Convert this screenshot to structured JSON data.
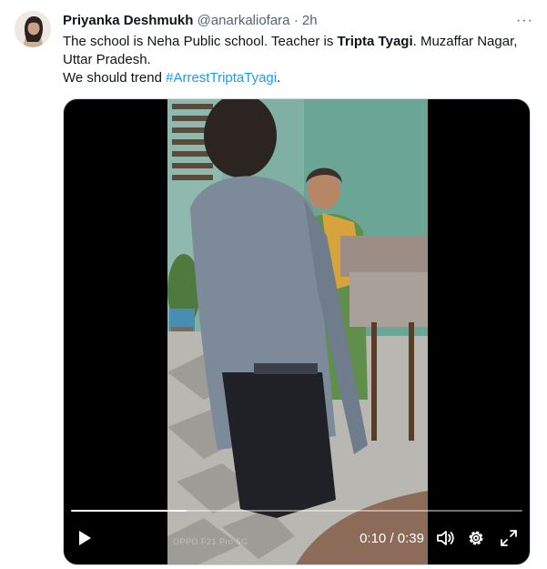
{
  "tweet": {
    "author_name": "Priyanka Deshmukh",
    "author_handle": "@anarkaliofara",
    "separator": "·",
    "time": "2h",
    "more_icon": "ellipsis-icon",
    "text": {
      "line1_a": "The school is Neha Public school. Teacher is ",
      "line1_bold": "Tripta Tyagi",
      "line1_b": ". Muzaffar Nagar,",
      "line2": "Uttar Pradesh.",
      "line3_a": "We should trend ",
      "hashtag": "#ArrestTriptaTyagi",
      "line3_b": "."
    }
  },
  "video": {
    "current_time": "0:10",
    "duration": "0:39",
    "time_separator": "/",
    "progress": 0.256,
    "watermark": "OPPO F21 Pro 5G",
    "icons": [
      "play-icon",
      "volume-icon",
      "settings-icon",
      "fullscreen-icon"
    ]
  },
  "colors": {
    "link": "#1d9bf0",
    "text": "#0f1419",
    "secondary": "#536471"
  }
}
